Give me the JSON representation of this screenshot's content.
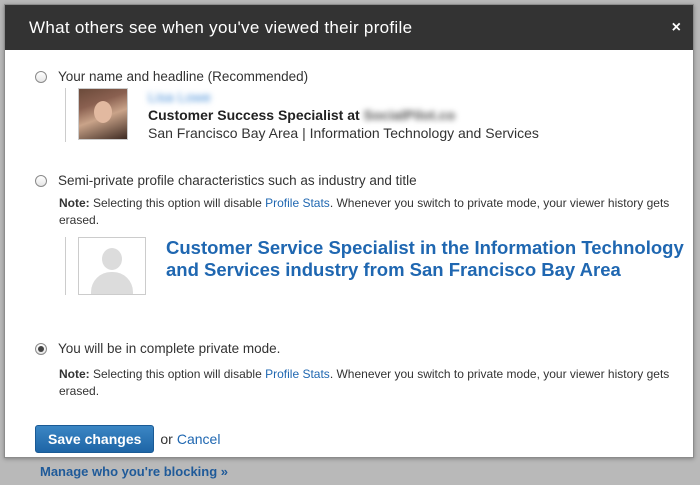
{
  "modal": {
    "title": "What others see when you've viewed their profile",
    "close_label": "×"
  },
  "options": {
    "name_headline": {
      "label": "Your name and headline (Recommended)",
      "selected": false,
      "preview": {
        "name": "Lisa Lowe",
        "headline_prefix": "Customer Success Specialist at",
        "company": "SocialPilot.co",
        "location": "San Francisco Bay Area | Information Technology and Services"
      }
    },
    "semi_private": {
      "label": "Semi-private profile characteristics such as industry and title",
      "selected": false,
      "note_prefix": "Note:",
      "note_before_link": " Selecting this option will disable ",
      "note_link": "Profile Stats",
      "note_after_link": ". Whenever you switch to private mode, your viewer history gets erased.",
      "preview_title": "Customer Service Specialist in the Information Technology and Services industry from San Francisco Bay Area"
    },
    "private_mode": {
      "label": "You will be in complete private mode.",
      "selected": true,
      "note_prefix": "Note:",
      "note_before_link": " Selecting this option will disable ",
      "note_link": "Profile Stats",
      "note_after_link": ". Whenever you switch to private mode, your viewer history gets erased."
    }
  },
  "actions": {
    "save_label": "Save changes",
    "or_label": "or",
    "cancel_label": "Cancel"
  },
  "background": {
    "manage_blocking_label": "Manage who you're blocking »"
  }
}
